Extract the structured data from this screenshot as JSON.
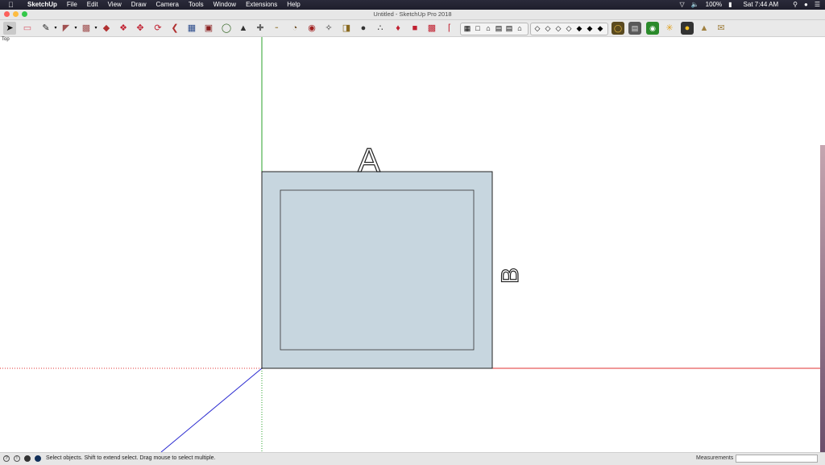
{
  "menubar": {
    "apple_icon": "apple-icon",
    "app_name": "SketchUp",
    "menus": [
      "File",
      "Edit",
      "View",
      "Draw",
      "Camera",
      "Tools",
      "Window",
      "Extensions",
      "Help"
    ],
    "battery": "100%",
    "clock": "Sat 7:44 AM"
  },
  "window": {
    "title": "Untitled - SketchUp Pro 2018",
    "traffic_colors": [
      "#fc605b",
      "#fdbc40",
      "#34c84a"
    ]
  },
  "viewport": {
    "view_label": "Top",
    "model_fill": "#c7d6df",
    "axis_colors": {
      "red": "#e03030",
      "green": "#2aa02a",
      "blue": "#2a2ad0"
    },
    "text_a": "A",
    "text_b": "B"
  },
  "statusbar": {
    "message": "Select objects. Shift to extend select. Drag mouse to select multiple.",
    "measurements_label": "Measurements",
    "measurements_value": ""
  }
}
